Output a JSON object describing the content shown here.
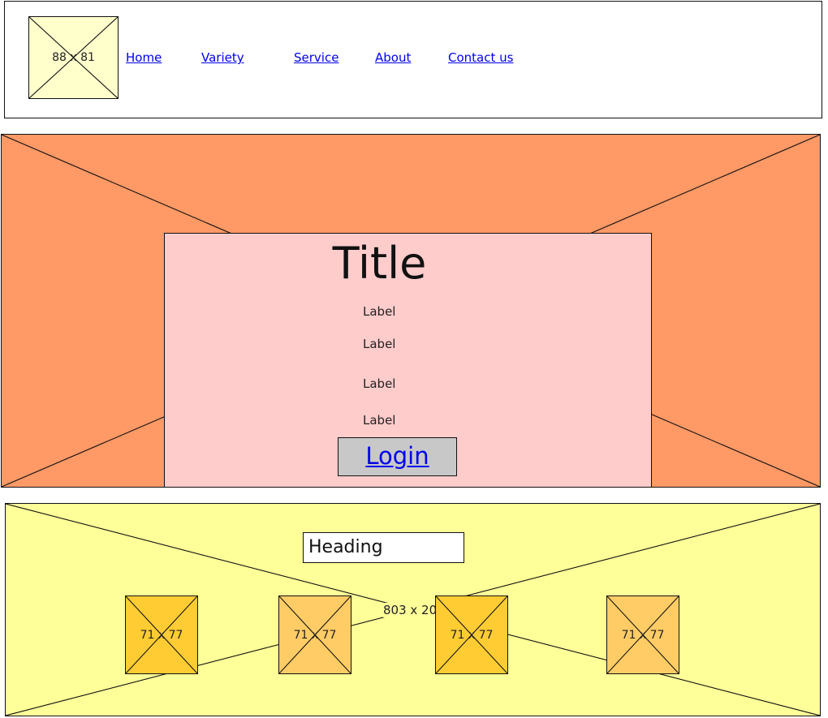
{
  "header": {
    "logo_placeholder": "88 x 81",
    "nav": [
      {
        "label": "Home"
      },
      {
        "label": "Variety"
      },
      {
        "label": "Service"
      },
      {
        "label": "About"
      },
      {
        "label": "Contact us"
      }
    ]
  },
  "hero": {
    "title": "Title",
    "labels": [
      "Label",
      "Label",
      "Label",
      "Label"
    ],
    "login_label": "Login"
  },
  "footer": {
    "heading": "Heading",
    "placeholder_label": "803 x 20",
    "thumbnails": [
      {
        "label": "71 x 77"
      },
      {
        "label": "71 x 77"
      },
      {
        "label": "71 x 77"
      },
      {
        "label": "71 x 77"
      }
    ]
  },
  "colors": {
    "hero_bg": "#ff9966",
    "card_bg": "#ffcccc",
    "footer_bg": "#ffff99",
    "logo_bg": "#ffffcc",
    "thumb_dark": "#ffcc33",
    "thumb_light": "#ffcc66",
    "button_bg": "#c8c8c8",
    "link": "#0000ee"
  }
}
